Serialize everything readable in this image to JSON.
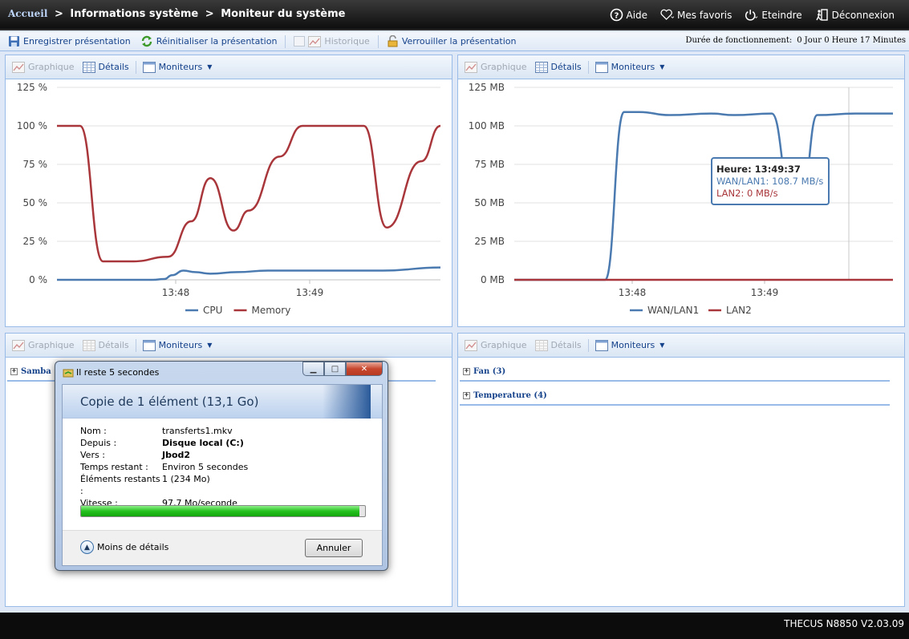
{
  "breadcrumb": {
    "home": "Accueil",
    "sep": ">",
    "level1": "Informations système",
    "level2": "Moniteur du système"
  },
  "topnav": {
    "help": "Aide",
    "favorites": "Mes favoris",
    "shutdown": "Eteindre",
    "logout": "Déconnexion"
  },
  "toolbar": {
    "save": "Enregistrer présentation",
    "reset": "Réinitialiser la présentation",
    "history": "Historique",
    "lock": "Verrouiller la présentation",
    "uptime_label": "Durée de fonctionnement:",
    "uptime_value": "0 Jour 0 Heure 17 Minutes"
  },
  "panel_toolbar": {
    "graph": "Graphique",
    "details": "Détails",
    "monitors": "Moniteurs"
  },
  "groups": {
    "samba": "Samba (1",
    "fan": "Fan (3)",
    "temperature": "Temperature (4)"
  },
  "tooltip": {
    "time": "Heure: 13:49:37",
    "wan": "WAN/LAN1: 108.7 MB/s",
    "lan2": "LAN2: 0 MB/s"
  },
  "dialog": {
    "title": "Il reste 5 secondes",
    "heading": "Copie de 1 élément (13,1 Go)",
    "fields": [
      {
        "k": "Nom :",
        "v": "transferts1.mkv",
        "bold": false
      },
      {
        "k": "Depuis :",
        "v": "Disque local (C:)",
        "bold": true
      },
      {
        "k": "Vers :",
        "v": "Jbod2",
        "bold": true
      },
      {
        "k": "Temps restant :",
        "v": "Environ 5 secondes",
        "bold": false
      },
      {
        "k": "Éléments restants :",
        "v": "1 (234 Mo)",
        "bold": false
      },
      {
        "k": "Vitesse :",
        "v": "97,7 Mo/seconde",
        "bold": false
      }
    ],
    "progress": 0.98,
    "less_details": "Moins de détails",
    "cancel": "Annuler"
  },
  "footer": {
    "version": "THECUS N8850 V2.03.09"
  },
  "chart_data": [
    {
      "type": "line",
      "ylim": [
        0,
        125
      ],
      "yticks": [
        "0 %",
        "25 %",
        "50 %",
        "75 %",
        "100 %",
        "125 %"
      ],
      "xticks": [
        "13:48",
        "13:49"
      ],
      "colors": {
        "CPU": "#4a7ab0",
        "Memory": "#a8363a"
      },
      "series": [
        {
          "name": "CPU",
          "points": [
            [
              0,
              0
            ],
            [
              0.25,
              0
            ],
            [
              0.28,
              0.5
            ],
            [
              0.3,
              3
            ],
            [
              0.33,
              6
            ],
            [
              0.36,
              5
            ],
            [
              0.4,
              4
            ],
            [
              0.47,
              5
            ],
            [
              0.55,
              6
            ],
            [
              0.65,
              6
            ],
            [
              0.72,
              6
            ],
            [
              0.85,
              6
            ],
            [
              1.0,
              8
            ]
          ]
        },
        {
          "name": "Memory",
          "points": [
            [
              0,
              100
            ],
            [
              0.06,
              100
            ],
            [
              0.12,
              12
            ],
            [
              0.2,
              12
            ],
            [
              0.29,
              15
            ],
            [
              0.35,
              38
            ],
            [
              0.4,
              66
            ],
            [
              0.46,
              32
            ],
            [
              0.5,
              45
            ],
            [
              0.58,
              80
            ],
            [
              0.64,
              100
            ],
            [
              0.8,
              100
            ],
            [
              0.86,
              34
            ],
            [
              0.95,
              77
            ],
            [
              1.0,
              100
            ]
          ]
        }
      ]
    },
    {
      "type": "line",
      "ylim": [
        0,
        125
      ],
      "yticks": [
        "0 MB",
        "25 MB",
        "50 MB",
        "75 MB",
        "100 MB",
        "125 MB"
      ],
      "xticks": [
        "13:48",
        "13:49"
      ],
      "colors": {
        "WAN/LAN1": "#4a7ab0",
        "LAN2": "#a8363a"
      },
      "series": [
        {
          "name": "WAN/LAN1",
          "points": [
            [
              0,
              0
            ],
            [
              0.24,
              0
            ],
            [
              0.29,
              109
            ],
            [
              0.33,
              109
            ],
            [
              0.41,
              107
            ],
            [
              0.52,
              108
            ],
            [
              0.58,
              107
            ],
            [
              0.68,
              108
            ],
            [
              0.73,
              57
            ],
            [
              0.76,
              55
            ],
            [
              0.8,
              107
            ],
            [
              0.9,
              108
            ],
            [
              0.96,
              108
            ],
            [
              1.0,
              108
            ]
          ]
        },
        {
          "name": "LAN2",
          "points": [
            [
              0,
              0
            ],
            [
              1.0,
              0
            ]
          ]
        }
      ]
    }
  ]
}
